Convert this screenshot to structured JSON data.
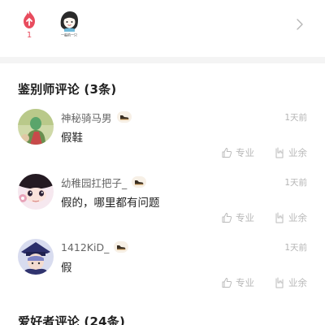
{
  "top": {
    "fire_count": "1",
    "avatar_caption": "一般的一只"
  },
  "sections": {
    "appraiser_title": "鉴别师评论 (3条)",
    "fan_title": "爱好者评论 (24条)"
  },
  "comments": [
    {
      "name": "神秘骑马男",
      "time": "1天前",
      "text": "假鞋",
      "pro_label": "专业",
      "amateur_label": "业余"
    },
    {
      "name": "幼稚园扛把子_",
      "time": "1天前",
      "text": "假的，哪里都有问题",
      "pro_label": "专业",
      "amateur_label": "业余"
    },
    {
      "name": "1412KiD_",
      "time": "1天前",
      "text": "假",
      "pro_label": "专业",
      "amateur_label": "业余"
    }
  ],
  "colors": {
    "accent": "#e84c5e",
    "muted": "#b8b8b8",
    "badge_bg": "#f7f0e6"
  },
  "icons": [
    "fire-icon",
    "chevron-right-icon",
    "sneaker-badge-icon",
    "thumb-up-icon",
    "rock-hand-icon"
  ]
}
